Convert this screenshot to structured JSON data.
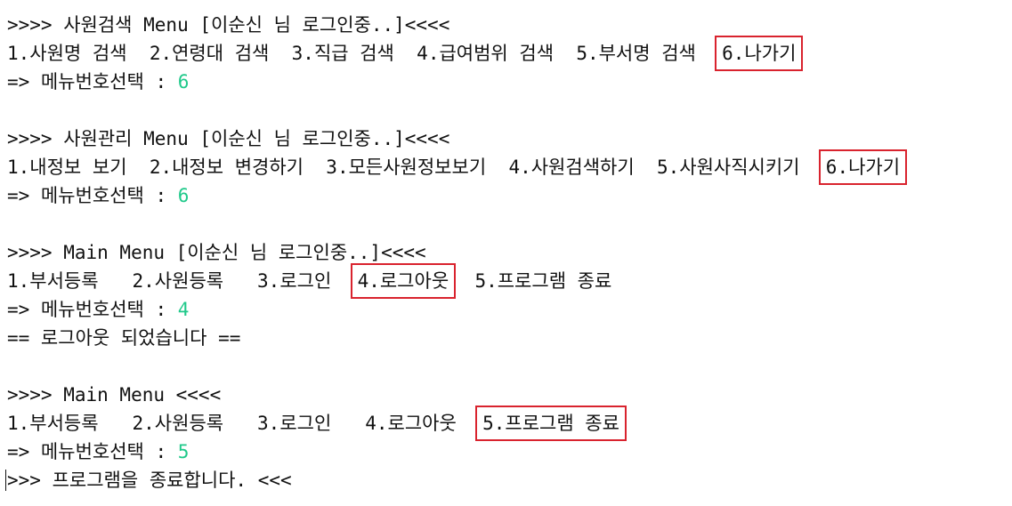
{
  "colors": {
    "input_value": "#1fc98a",
    "highlight_box": "#d9232e",
    "text": "#111111",
    "background": "#ffffff"
  },
  "block1": {
    "header": ">>>> 사원검색 Menu [이순신 님 로그인중..]<<<<",
    "options": [
      "1.사원명 검색",
      "2.연령대 검색",
      "3.직급 검색",
      "4.급여범위 검색",
      "5.부서명 검색",
      "6.나가기"
    ],
    "prompt": "=> 메뉴번호선택 :",
    "input": "6"
  },
  "block2": {
    "header": ">>>> 사원관리 Menu [이순신 님 로그인중..]<<<<",
    "options": [
      "1.내정보 보기",
      "2.내정보 변경하기",
      "3.모든사원정보보기",
      "4.사원검색하기",
      "5.사원사직시키기",
      "6.나가기"
    ],
    "prompt": "=> 메뉴번호선택 :",
    "input": "6"
  },
  "block3": {
    "header": ">>>> Main Menu [이순신 님 로그인중..]<<<<",
    "options": [
      "1.부서등록",
      "2.사원등록",
      "3.로그인",
      "4.로그아웃",
      "5.프로그램 종료"
    ],
    "prompt": "=> 메뉴번호선택 :",
    "input": "4",
    "message": "== 로그아웃 되었습니다 =="
  },
  "block4": {
    "header": ">>>> Main Menu <<<<",
    "options": [
      "1.부서등록",
      "2.사원등록",
      "3.로그인",
      "4.로그아웃",
      "5.프로그램 종료"
    ],
    "prompt": "=> 메뉴번호선택 :",
    "input": "5",
    "message": ">>> 프로그램을 종료합니다. <<<"
  }
}
